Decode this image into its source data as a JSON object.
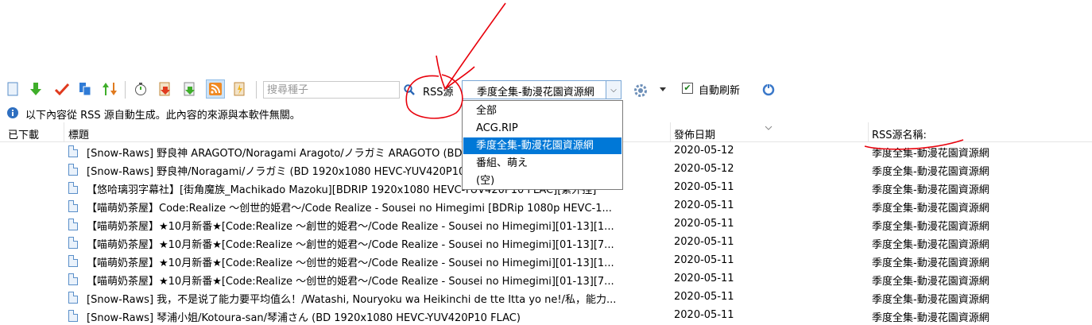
{
  "toolbar": {
    "icons": [
      "new-icon",
      "download-green-icon",
      "check-red-icon",
      "copy-icon",
      "sort-icon",
      "timer-icon",
      "import-icon",
      "export-icon",
      "rss-feed-icon",
      "rss-refresh-icon"
    ],
    "search_placeholder": "搜尋種子",
    "rss_label": "RSS源",
    "rss_selected": "季度全集-動漫花園資源網",
    "auto_refresh_label": "自動刷新",
    "auto_refresh_checked": true
  },
  "dropdown": {
    "options": [
      "全部",
      "ACG.RIP",
      "季度全集-動漫花園資源網",
      "番組、萌え",
      "(空)"
    ],
    "selected_index": 2
  },
  "info": {
    "text": "以下內容從 RSS 源自動生成。此內容的來源與本軟件無關。"
  },
  "table": {
    "headers": {
      "downloaded": "已下載",
      "title": "標題",
      "date": "發佈日期",
      "source": "RSS源名稱:"
    },
    "rows": [
      {
        "title": "[Snow-Raws] 野良神 ARAGOTO/Noragami Aragoto/ノラガミ ARAGOTO (BD 1920x1080 HEVC-YUV420...",
        "date": "2020-05-12",
        "source": "季度全集-動漫花園資源網"
      },
      {
        "title": "[Snow-Raws] 野良神/Noragami/ノラガミ (BD 1920x1080 HEVC-YUV420P10 FLAC)",
        "date": "2020-05-12",
        "source": "季度全集-動漫花園資源網"
      },
      {
        "title": "【悠哈璃羽字幕社】[街角魔族_Machikado Mazoku][BDRIP 1920x1080 HEVC-YUV420P10 FLAC][繁外挂]",
        "date": "2020-05-11",
        "source": "季度全集-動漫花園資源網"
      },
      {
        "title": "【喵萌奶茶屋】Code:Realize ～创世的姫君～/Code Realize - Sousei no Himegimi  [BDRip 1080p HEVC-1...",
        "date": "2020-05-11",
        "source": "季度全集-動漫花園資源網"
      },
      {
        "title": "【喵萌奶茶屋】★10月新番★[Code:Realize ～創世的姫君～/Code Realize - Sousei no Himegimi][01-13][1...",
        "date": "2020-05-11",
        "source": "季度全集-動漫花園資源網"
      },
      {
        "title": "【喵萌奶茶屋】★10月新番★[Code:Realize ～創世的姫君～/Code Realize - Sousei no Himegimi][01-13][7...",
        "date": "2020-05-11",
        "source": "季度全集-動漫花園資源網"
      },
      {
        "title": "【喵萌奶茶屋】★10月新番★[Code:Realize ～创世的姫君～/Code Realize - Sousei no Himegimi][01-13][1...",
        "date": "2020-05-11",
        "source": "季度全集-動漫花園資源網"
      },
      {
        "title": "【喵萌奶茶屋】★10月新番★[Code:Realize ～创世的姫君～/Code Realize - Sousei no Himegimi][01-13][7...",
        "date": "2020-05-11",
        "source": "季度全集-動漫花園資源網"
      },
      {
        "title": "[Snow-Raws] 我，不是说了能力要平均值么！/Watashi, Nouryoku wa Heikinchi de tte Itta yo ne!/私，能力...",
        "date": "2020-05-11",
        "source": "季度全集-動漫花園資源網"
      },
      {
        "title": "[Snow-Raws] 琴浦小姐/Kotoura-san/琴浦さん (BD 1920x1080 HEVC-YUV420P10 FLAC)",
        "date": "2020-05-11",
        "source": "季度全集-動漫花園資源網"
      }
    ]
  },
  "colors": {
    "selection": "#0078d7",
    "annotation": "#e8000b",
    "combo_border": "#7aa7d6"
  }
}
